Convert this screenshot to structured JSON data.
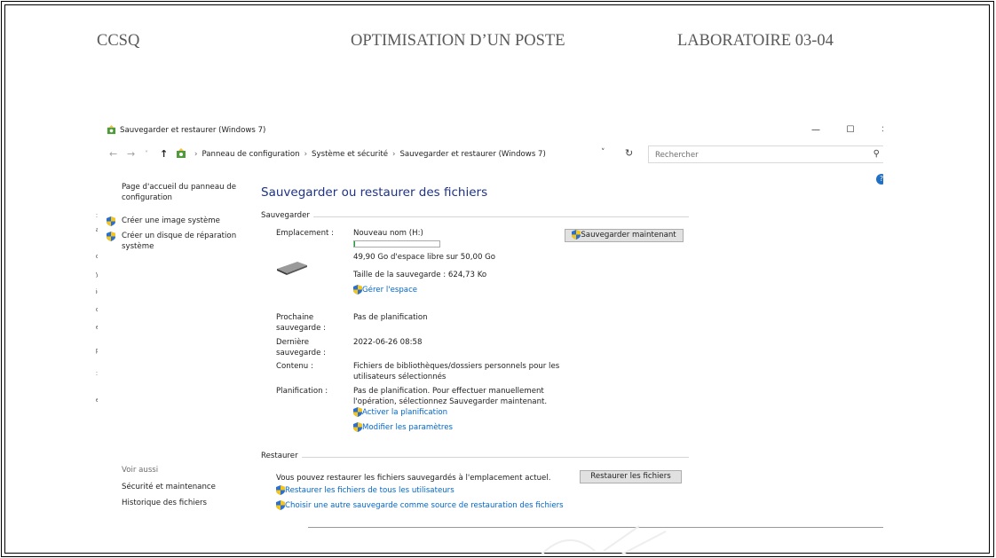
{
  "doc_header": {
    "left": "CCSQ",
    "center": "OPTIMISATION D’UN POSTE",
    "right": "LABORATOIRE 03-04"
  },
  "window": {
    "title": "Sauvegarder et restaurer (Windows 7)",
    "minimize": "—",
    "maximize": "☐",
    "close": "✕"
  },
  "address_bar": {
    "back": "←",
    "forward": "→",
    "recent": "˅",
    "up": "↑",
    "crumbs": [
      "Panneau de configuration",
      "Système et sécurité",
      "Sauvegarder et restaurer (Windows 7)"
    ],
    "separator": "›",
    "dropdown": "˅",
    "refresh": "↻",
    "search_placeholder": "Rechercher",
    "search_icon": "⚲"
  },
  "help_glyph": "?",
  "sidebar": {
    "home_link": "Page d'accueil du panneau de configuration",
    "tasks": [
      {
        "label": "Créer une image système",
        "icon": "shield-icon"
      },
      {
        "label": "Créer un disque de réparation système",
        "icon": "shield-icon"
      }
    ],
    "see_also_title": "Voir aussi",
    "see_also": [
      "Sécurité et maintenance",
      "Historique des fichiers"
    ]
  },
  "main": {
    "title": "Sauvegarder ou restaurer des fichiers",
    "backup": {
      "group_label": "Sauvegarder",
      "location_label": "Emplacement :",
      "location_value": "Nouveau nom (H:)",
      "progress_fraction": 0.002,
      "free_space": "49,90 Go d'espace libre sur 50,00 Go",
      "backup_size": "Taille de la sauvegarde : 624,73 Ko",
      "manage_space_link": "Gérer l'espace",
      "backup_now_button": "Sauvegarder maintenant",
      "next_label": "Prochaine sauvegarde :",
      "next_value": "Pas de planification",
      "last_label": "Dernière sauvegarde :",
      "last_value": "2022-06-26 08:58",
      "contents_label": "Contenu :",
      "contents_value": "Fichiers de bibliothèques/dossiers personnels pour les utilisateurs sélectionnés",
      "schedule_label": "Planification :",
      "schedule_value": "Pas de planification. Pour effectuer manuellement l'opération, sélectionnez Sauvegarder maintenant.",
      "activate_schedule_link": "Activer la planification",
      "change_settings_link": "Modifier les paramètres"
    },
    "restore": {
      "group_label": "Restaurer",
      "description": "Vous pouvez restaurer les fichiers sauvegardés à l'emplacement actuel.",
      "restore_button": "Restaurer les fichiers",
      "restore_all_link": "Restaurer les fichiers de tous les utilisateurs",
      "choose_other_link": "Choisir une autre sauvegarde comme source de restauration des fichiers"
    }
  },
  "colors": {
    "title_blue": "#1e3287",
    "link_blue": "#0066cc",
    "header_gray": "#595959",
    "progress_green": "#06b025"
  }
}
